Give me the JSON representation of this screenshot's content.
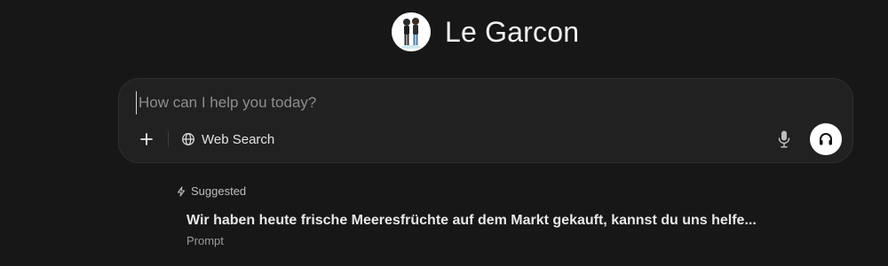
{
  "header": {
    "avatar_icon": "couple-avatar-icon",
    "title": "Le Garcon"
  },
  "composer": {
    "placeholder": "How can I help you today?",
    "value": "",
    "add_icon": "plus-icon",
    "web_search_icon": "globe-icon",
    "web_search_label": "Web Search",
    "mic_icon": "microphone-icon",
    "voice_icon": "headphones-icon"
  },
  "suggestions": {
    "header_icon": "lightning-icon",
    "header_label": "Suggested",
    "items": [
      {
        "text": "Wir haben heute frische Meeresfrüchte auf dem Markt gekauft, kannst du uns helfe...",
        "kind": "Prompt"
      }
    ]
  },
  "colors": {
    "background": "#171717",
    "composer_background": "#212121",
    "accent_button": "#ffffff"
  }
}
